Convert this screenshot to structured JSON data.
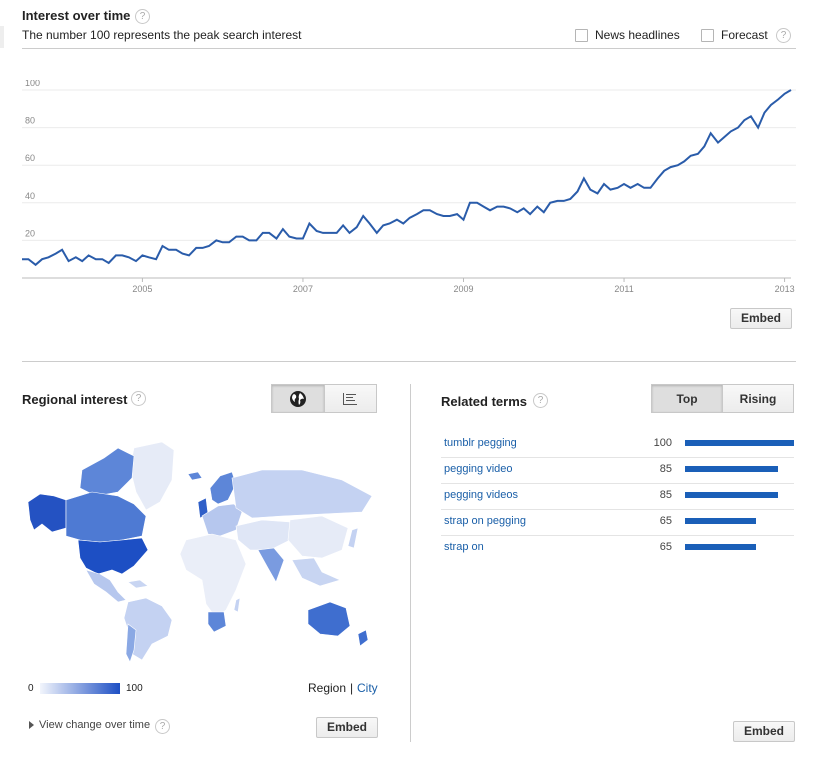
{
  "interest_over_time": {
    "title": "Interest over time",
    "subtitle": "The number 100 represents the peak search interest",
    "help": "?",
    "news_headlines_label": "News headlines",
    "forecast_label": "Forecast",
    "embed_label": "Embed"
  },
  "chart_data": {
    "type": "line",
    "y_ticks": [
      "20",
      "40",
      "60",
      "80",
      "100"
    ],
    "x_ticks": [
      "2005",
      "2007",
      "2009",
      "2011",
      "2013"
    ],
    "ylim": [
      0,
      100
    ],
    "xlim": [
      2004.0,
      2013.58
    ],
    "grid": true,
    "line_color": "#2a5caa",
    "x": [
      2004.0,
      2004.08,
      2004.17,
      2004.25,
      2004.33,
      2004.42,
      2004.5,
      2004.58,
      2004.67,
      2004.75,
      2004.83,
      2004.92,
      2005.0,
      2005.08,
      2005.17,
      2005.25,
      2005.33,
      2005.42,
      2005.5,
      2005.58,
      2005.67,
      2005.75,
      2005.83,
      2005.92,
      2006.0,
      2006.08,
      2006.17,
      2006.25,
      2006.33,
      2006.42,
      2006.5,
      2006.58,
      2006.67,
      2006.75,
      2006.83,
      2006.92,
      2007.0,
      2007.08,
      2007.17,
      2007.25,
      2007.33,
      2007.42,
      2007.5,
      2007.58,
      2007.67,
      2007.75,
      2007.83,
      2007.92,
      2008.0,
      2008.08,
      2008.17,
      2008.25,
      2008.33,
      2008.42,
      2008.5,
      2008.58,
      2008.67,
      2008.75,
      2008.83,
      2008.92,
      2009.0,
      2009.08,
      2009.17,
      2009.25,
      2009.33,
      2009.42,
      2009.5,
      2009.58,
      2009.67,
      2009.75,
      2009.83,
      2009.92,
      2010.0,
      2010.08,
      2010.17,
      2010.25,
      2010.33,
      2010.42,
      2010.5,
      2010.58,
      2010.67,
      2010.75,
      2010.83,
      2010.92,
      2011.0,
      2011.08,
      2011.17,
      2011.25,
      2011.33,
      2011.42,
      2011.5,
      2011.58,
      2011.67,
      2011.75,
      2011.83,
      2011.92,
      2012.0,
      2012.08,
      2012.17,
      2012.25,
      2012.33,
      2012.42,
      2012.5,
      2012.58,
      2012.67,
      2012.75,
      2012.83,
      2012.92,
      2013.0,
      2013.08,
      2013.17,
      2013.25,
      2013.33,
      2013.42,
      2013.5,
      2013.58
    ],
    "values": [
      10,
      10,
      7,
      10,
      11,
      13,
      15,
      9,
      11,
      9,
      12,
      10,
      10,
      8,
      12,
      12,
      11,
      9,
      12,
      11,
      10,
      17,
      15,
      15,
      13,
      12,
      16,
      16,
      17,
      20,
      19,
      19,
      22,
      22,
      20,
      20,
      24,
      24,
      21,
      26,
      22,
      21,
      21,
      29,
      25,
      24,
      24,
      24,
      28,
      24,
      27,
      33,
      29,
      24,
      28,
      29,
      31,
      29,
      32,
      34,
      36,
      36,
      34,
      33,
      33,
      34,
      31,
      40,
      40,
      38,
      36,
      38,
      38,
      37,
      35,
      37,
      34,
      38,
      35,
      40,
      41,
      41,
      42,
      46,
      53,
      47,
      45,
      50,
      47,
      48,
      50,
      48,
      50,
      48,
      48,
      53,
      57,
      59,
      60,
      62,
      65,
      66,
      70,
      77,
      72,
      75,
      78,
      80,
      84,
      86,
      80,
      88,
      92,
      95,
      98,
      100
    ]
  },
  "regional": {
    "title": "Regional interest",
    "help": "?",
    "legend_min": "0",
    "legend_max": "100",
    "region_label": "Region",
    "separator": "|",
    "city_label": "City",
    "view_change_label": "View change over time",
    "embed_label": "Embed",
    "globe_icon": "globe-icon",
    "list_icon": "list-icon"
  },
  "related": {
    "title": "Related terms",
    "help": "?",
    "tab_top": "Top",
    "tab_rising": "Rising",
    "embed_label": "Embed",
    "bar_color": "#1a5fb8",
    "terms": [
      {
        "term": "tumblr pegging",
        "value": 100
      },
      {
        "term": "pegging video",
        "value": 85
      },
      {
        "term": "pegging videos",
        "value": 85
      },
      {
        "term": "strap on pegging",
        "value": 65
      },
      {
        "term": "strap on",
        "value": 65
      }
    ]
  }
}
